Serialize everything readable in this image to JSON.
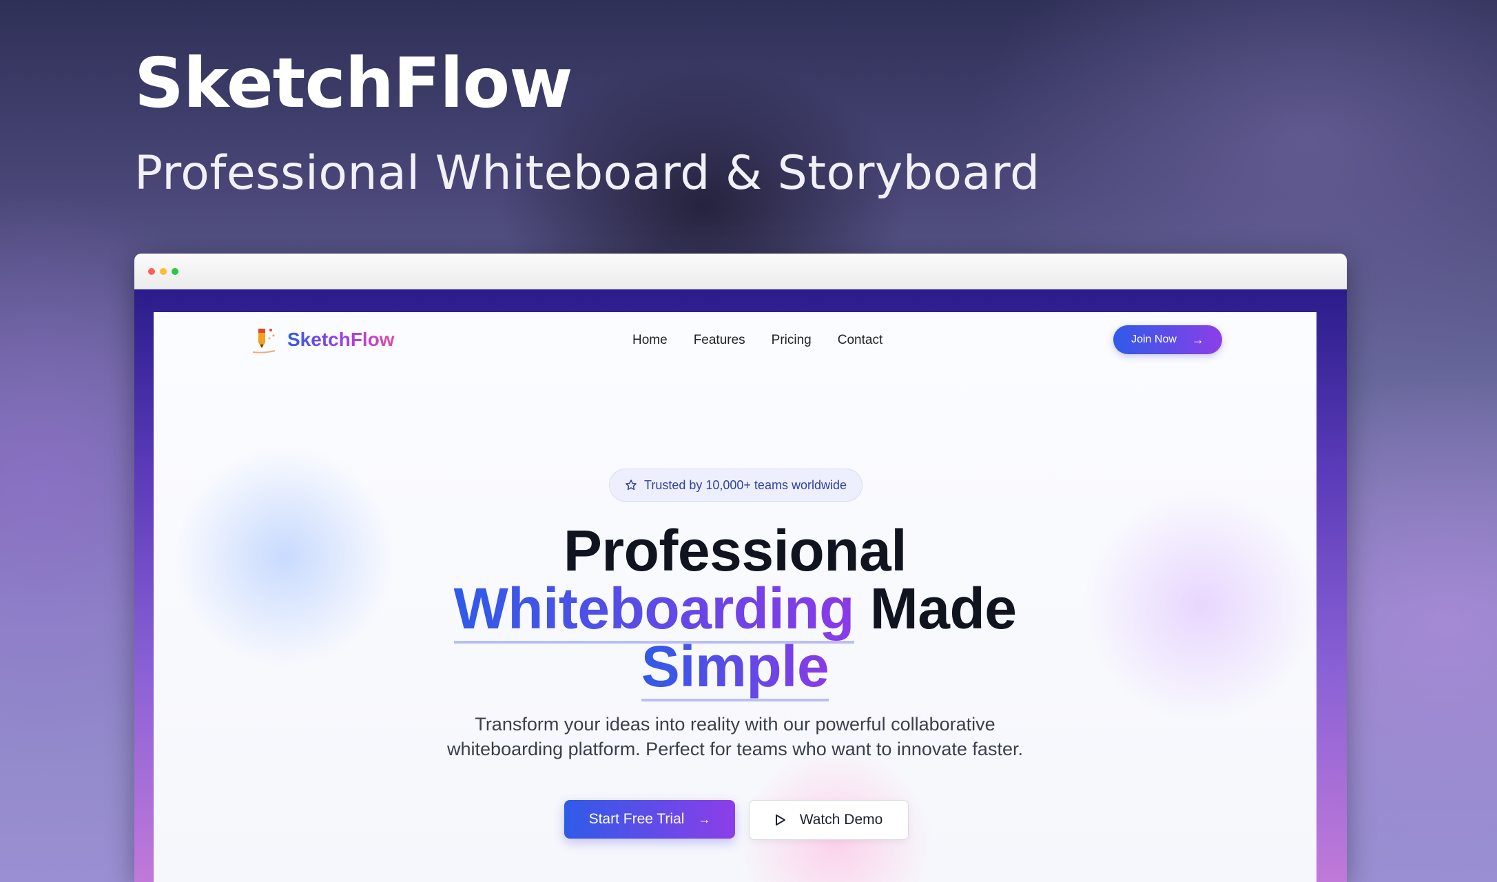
{
  "banner": {
    "title": "SketchFlow",
    "subtitle": "Professional Whiteboard & Storyboard"
  },
  "nav": {
    "brand": "SketchFlow",
    "links": [
      "Home",
      "Features",
      "Pricing",
      "Contact"
    ],
    "join_label": "Join Now"
  },
  "hero": {
    "badge": "Trusted by 10,000+ teams worldwide",
    "headline": {
      "line1": "Professional",
      "highlight1": "Whiteboarding",
      "line2_rest": " Made",
      "highlight2": "Simple"
    },
    "description_line1": "Transform your ideas into reality with our powerful collaborative",
    "description_line2": "whiteboarding platform. Perfect for teams who want to innovate faster.",
    "primary_cta": "Start Free Trial",
    "secondary_cta": "Watch Demo"
  },
  "icons": {
    "logo": "pencil-sparkle-icon",
    "join_arrow": "arrow-right-icon",
    "badge": "star-icon",
    "cta_arrow": "arrow-right-icon",
    "demo": "play-icon"
  },
  "colors": {
    "accent_start": "#2f5be8",
    "accent_end": "#8d3ee8",
    "headline_text": "#10141f"
  }
}
